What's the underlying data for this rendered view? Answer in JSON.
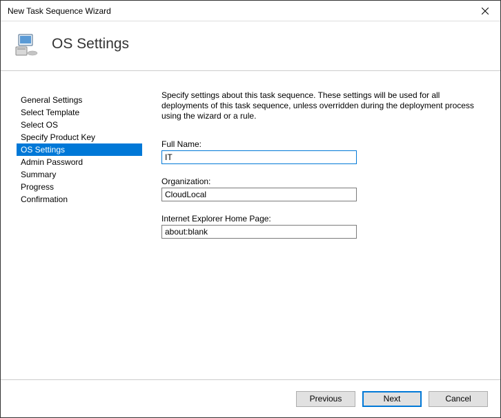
{
  "window": {
    "title": "New Task Sequence Wizard"
  },
  "header": {
    "title": "OS Settings"
  },
  "sidebar": {
    "items": [
      {
        "label": "General Settings",
        "active": false
      },
      {
        "label": "Select Template",
        "active": false
      },
      {
        "label": "Select OS",
        "active": false
      },
      {
        "label": "Specify Product Key",
        "active": false
      },
      {
        "label": "OS Settings",
        "active": true
      },
      {
        "label": "Admin Password",
        "active": false
      },
      {
        "label": "Summary",
        "active": false
      },
      {
        "label": "Progress",
        "active": false
      },
      {
        "label": "Confirmation",
        "active": false
      }
    ]
  },
  "main": {
    "description": "Specify settings about this task sequence.  These settings will be used for all deployments of this task sequence, unless overridden during the deployment process using the wizard or a rule.",
    "fields": {
      "fullname_label": "Full Name:",
      "fullname_value": "IT",
      "organization_label": "Organization:",
      "organization_value": "CloudLocal",
      "iehome_label": "Internet Explorer Home Page:",
      "iehome_value": "about:blank"
    }
  },
  "footer": {
    "previous": "Previous",
    "next": "Next",
    "cancel": "Cancel"
  }
}
